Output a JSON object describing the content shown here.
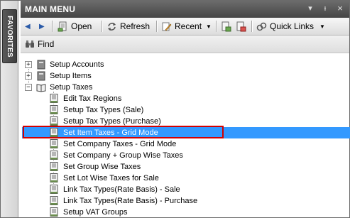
{
  "favorites_tab": "FAVORITES",
  "title": "MAIN MENU",
  "window_controls": {
    "menu": "▾",
    "pin": "ᵻ",
    "close": "×"
  },
  "toolbar": {
    "back": "◀",
    "forward": "▶",
    "open": "Open",
    "refresh": "Refresh",
    "recent": "Recent",
    "quick_links": "Quick Links"
  },
  "find": "Find",
  "tree": {
    "setup_accounts": "Setup Accounts",
    "setup_items": "Setup Items",
    "setup_taxes": "Setup Taxes",
    "children": [
      "Edit Tax Regions",
      "Setup Tax Types (Sale)",
      "Setup Tax Types (Purchase)",
      "Set Item Taxes - Grid Mode",
      "Set Company Taxes - Grid Mode",
      "Set Company + Group Wise Taxes",
      "Set Group Wise Taxes",
      "Set Lot Wise Taxes for Sale",
      "Link Tax Types(Rate Basis) - Sale",
      "Link Tax Types(Rate Basis) - Purchase",
      "Setup VAT Groups"
    ],
    "expand_plus": "+",
    "expand_minus": "−"
  },
  "colors": {
    "selection": "#3399ff",
    "highlight_border": "#d40000"
  }
}
